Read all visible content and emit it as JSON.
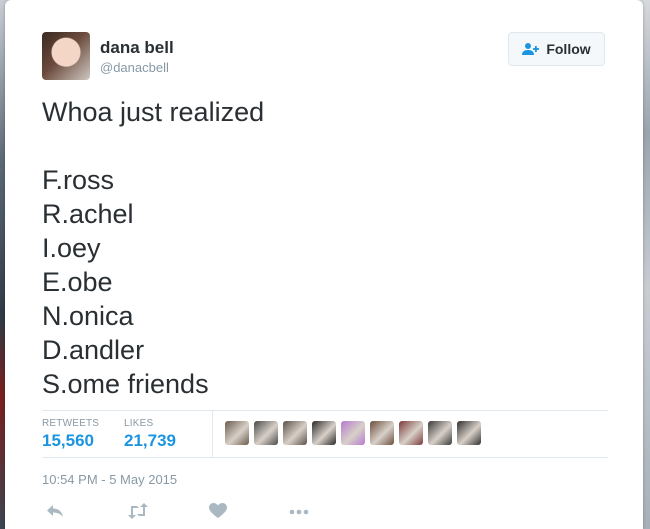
{
  "user": {
    "name": "dana bell",
    "handle": "@danacbell"
  },
  "follow_button": {
    "label": "Follow"
  },
  "tweet": {
    "lines": [
      "Whoa just realized",
      "",
      "F.ross",
      "R.achel",
      "I.oey",
      "E.obe",
      "N.onica",
      "D.andler",
      "S.ome friends"
    ]
  },
  "stats": {
    "retweets_label": "RETWEETS",
    "retweets_value": "15,560",
    "likes_label": "LIKES",
    "likes_value": "21,739"
  },
  "facepile": {
    "avatar_colors": [
      "#6a5a4a",
      "#4a4a4a",
      "#5b5148",
      "#2a2a2a",
      "#b77ad0",
      "#6b4e3d",
      "#7a3a3a",
      "#3a3a3a",
      "#2f2f2f"
    ]
  },
  "timestamp": "10:54 PM - 5 May 2015",
  "actions": {
    "icons": [
      "reply-icon",
      "retweet-icon",
      "like-icon",
      "more-icon"
    ]
  },
  "colors": {
    "link_blue": "#1b95e0",
    "text_primary": "#292f33",
    "text_secondary": "#8899a6",
    "action_gray": "#aab8c2"
  }
}
